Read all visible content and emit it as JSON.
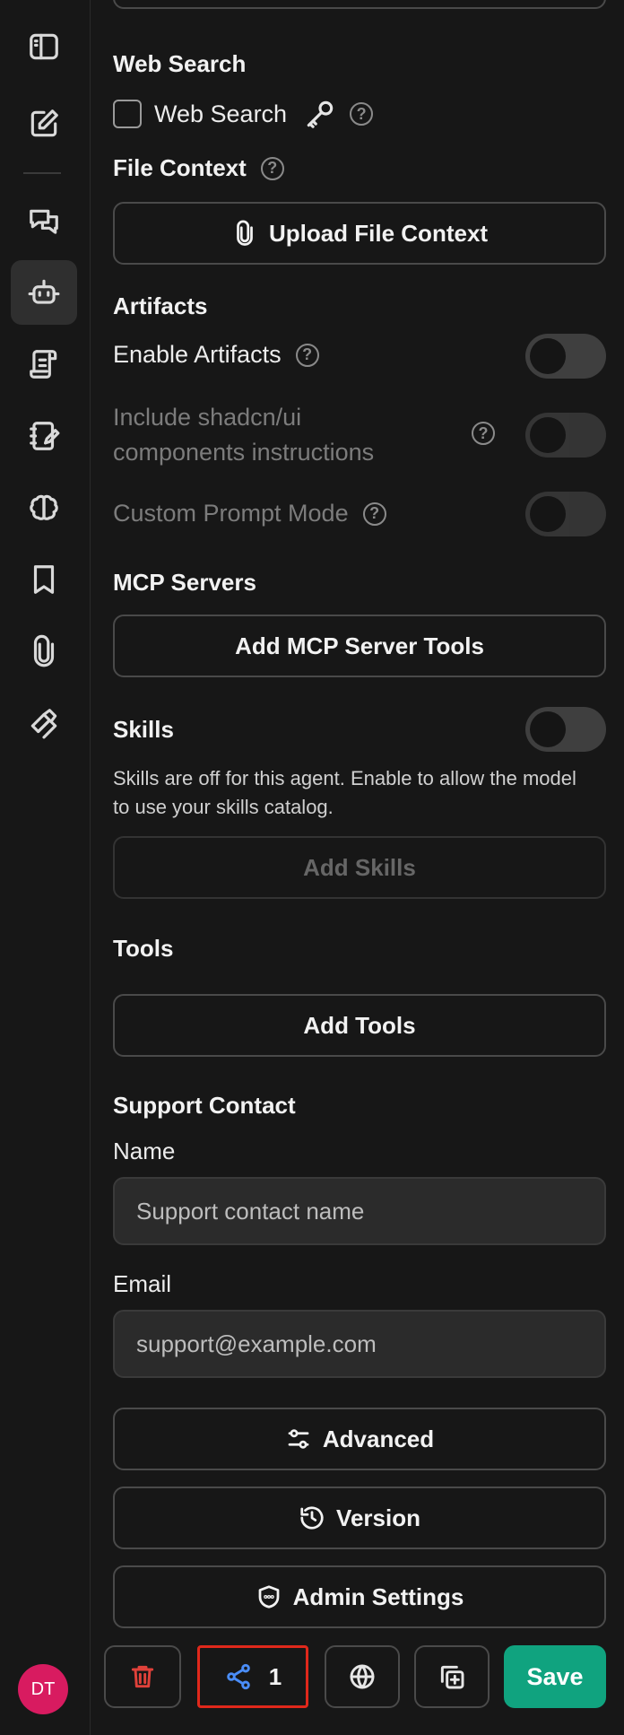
{
  "rail": {
    "icons": [
      "sidebar-toggle-icon",
      "new-chat-icon",
      "chats-icon",
      "agents-icon",
      "prompts-icon",
      "notes-icon",
      "memory-icon",
      "bookmark-icon",
      "attachments-icon",
      "skills-icon"
    ],
    "avatar_initials": "DT"
  },
  "web_search": {
    "heading": "Web Search",
    "checkbox_label": "Web Search"
  },
  "file_context": {
    "heading": "File Context",
    "button": "Upload File Context"
  },
  "artifacts": {
    "heading": "Artifacts",
    "enable_label": "Enable Artifacts",
    "shadcn_label": "Include shadcn/ui components instructions",
    "custom_prompt_label": "Custom Prompt Mode"
  },
  "mcp": {
    "heading": "MCP Servers",
    "button": "Add MCP Server Tools"
  },
  "skills": {
    "heading": "Skills",
    "description": "Skills are off for this agent. Enable to allow the model to use your skills catalog.",
    "button": "Add Skills"
  },
  "tools": {
    "heading": "Tools",
    "button": "Add Tools"
  },
  "support": {
    "heading": "Support Contact",
    "name_label": "Name",
    "name_placeholder": "Support contact name",
    "email_label": "Email",
    "email_placeholder": "support@example.com"
  },
  "actions": {
    "advanced": "Advanced",
    "version": "Version",
    "admin_settings": "Admin Settings"
  },
  "footer": {
    "share_count": "1",
    "save": "Save"
  },
  "colors": {
    "accent_green": "#10a37f",
    "avatar": "#d81b60",
    "share_highlight": "#e0281b",
    "share_icon": "#4a8df8",
    "delete_icon": "#e0413a"
  }
}
